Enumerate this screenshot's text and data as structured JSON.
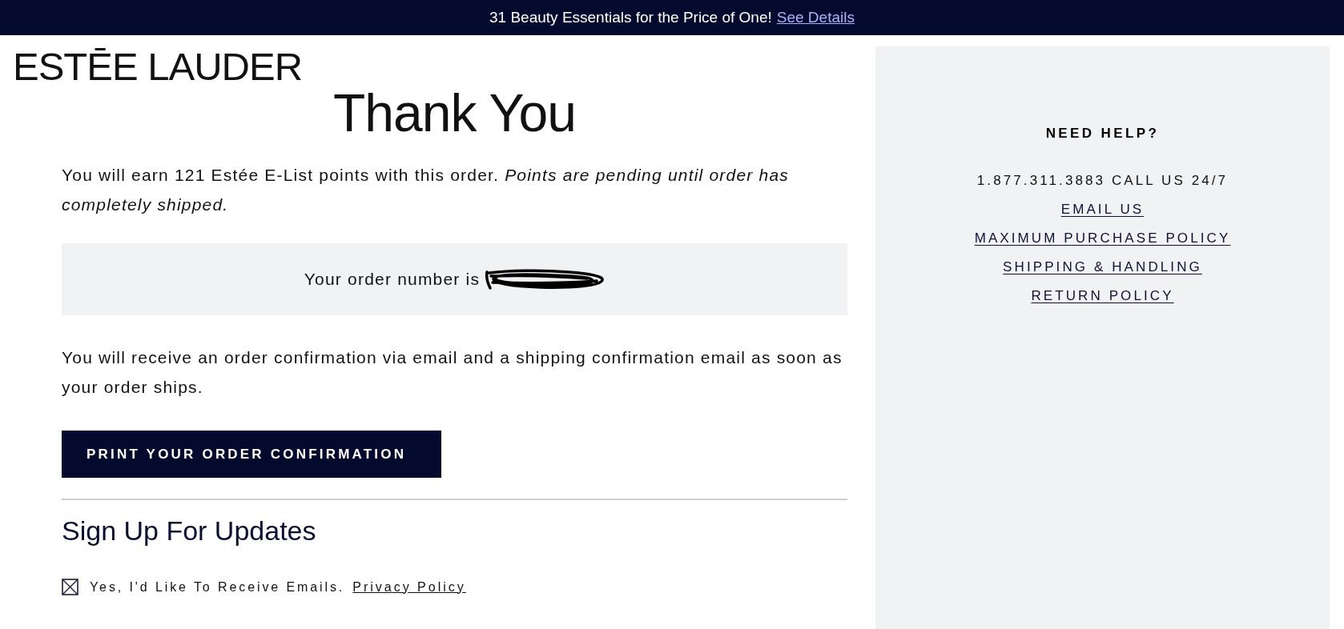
{
  "banner": {
    "text": "31 Beauty Essentials for the Price of One!",
    "link": "See Details"
  },
  "logo": "ESTĒE LAUDER",
  "main": {
    "title": "Thank You",
    "points_note": "You will earn 121 Estée E-List points with this order. *Points are pending until order has completely shipped.*",
    "order_number_label": "Your order number is",
    "confirmation_note": "You will receive an order confirmation via email and a shipping confirmation email as soon as your order ships.",
    "print_button": "PRINT YOUR ORDER CONFIRMATION"
  },
  "signup": {
    "title": "Sign Up For Updates",
    "checkbox": {
      "label": "Yes, I'd Like To Receive Emails.",
      "checked": true
    },
    "privacy_link": "Privacy Policy"
  },
  "help": {
    "title": "NEED HELP?",
    "items": [
      {
        "kind": "text",
        "label": "1.877.311.3883 CALL US 24/7"
      },
      {
        "kind": "link",
        "label": "EMAIL US"
      },
      {
        "kind": "link",
        "label": "MAXIMUM PURCHASE POLICY"
      },
      {
        "kind": "link",
        "label": "SHIPPING & HANDLING"
      },
      {
        "kind": "link",
        "label": "RETURN POLICY"
      }
    ]
  }
}
